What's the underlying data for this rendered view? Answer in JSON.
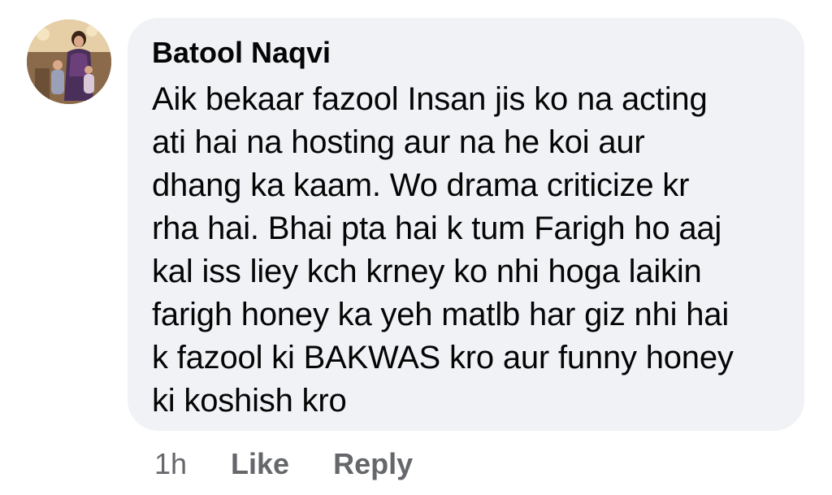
{
  "comment": {
    "author": "Batool Naqvi",
    "avatar_icon": "profile-photo",
    "lines": [
      "Aik bekaar fazool Insan jis ko na acting",
      "ati hai na hosting aur na he koi aur",
      "dhang ka kaam. Wo drama criticize kr",
      "rha hai. Bhai pta hai k tum Farigh ho aaj",
      "kal iss liey kch krney ko nhi hoga laikin",
      "farigh honey ka yeh matlb har giz nhi hai",
      "k fazool ki BAKWAS kro aur funny honey",
      "ki koshish kro"
    ],
    "bubble_color": "#f0f2f5",
    "meta_color": "#65676b"
  },
  "actions": {
    "time": "1h",
    "like_label": "Like",
    "reply_label": "Reply"
  }
}
